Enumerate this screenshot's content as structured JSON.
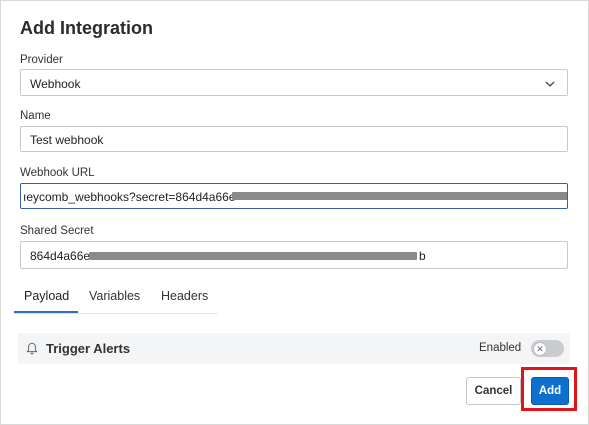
{
  "dialog": {
    "title": "Add Integration"
  },
  "provider": {
    "label": "Provider",
    "value": "Webhook"
  },
  "name": {
    "label": "Name",
    "value": "Test webhook"
  },
  "webhook_url": {
    "label": "Webhook URL",
    "value_visible": "ıeycomb_webhooks?secret=864d4a66e"
  },
  "shared_secret": {
    "label": "Shared Secret",
    "value_start": "864d4a66e",
    "value_end": "b"
  },
  "tabs": [
    {
      "label": "Payload",
      "active": true
    },
    {
      "label": "Variables",
      "active": false
    },
    {
      "label": "Headers",
      "active": false
    }
  ],
  "trigger_alerts": {
    "title": "Trigger Alerts",
    "enabled_label": "Enabled",
    "enabled": false
  },
  "footer": {
    "cancel_label": "Cancel",
    "add_label": "Add"
  },
  "colors": {
    "primary": "#0f6fcf",
    "highlight": "#e0151b",
    "tab_underline": "#2f6fbf"
  }
}
